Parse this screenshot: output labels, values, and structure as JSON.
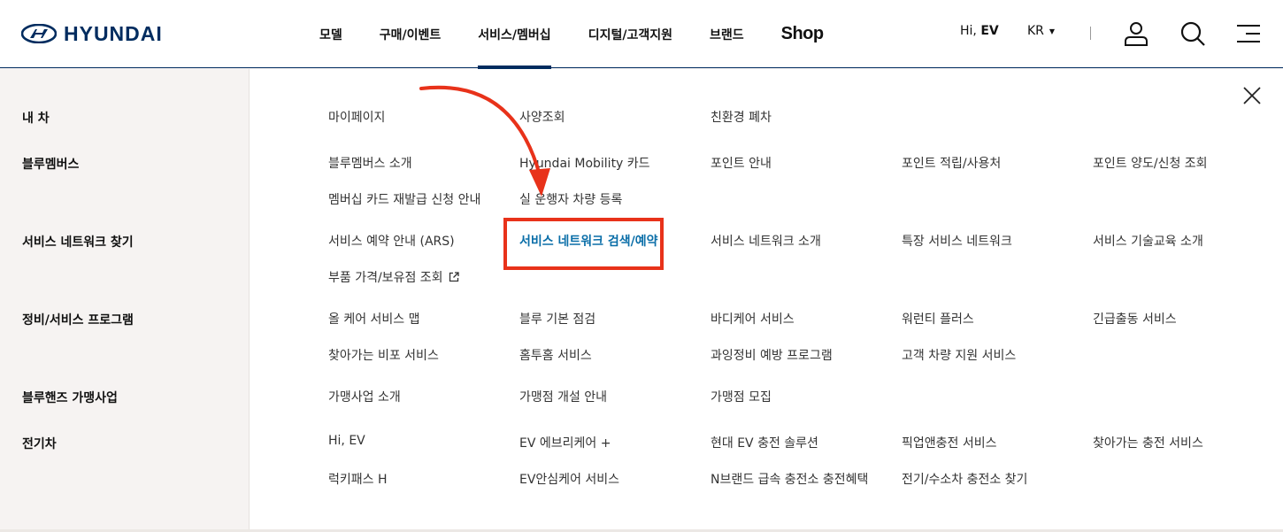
{
  "brand": {
    "logo_text": "HYUNDAI",
    "color": "#002c5f"
  },
  "header": {
    "nav": [
      {
        "label": "모델"
      },
      {
        "label": "구매/이벤트"
      },
      {
        "label": "서비스/멤버십",
        "active": true
      },
      {
        "label": "디지털/고객지원"
      },
      {
        "label": "브랜드"
      },
      {
        "label": "Shop"
      }
    ],
    "greeting_prefix": "Hi, ",
    "greeting_name": "EV",
    "lang": "KR",
    "icons": [
      "user-icon",
      "search-icon",
      "menu-icon"
    ]
  },
  "menu": {
    "categories": [
      {
        "label": "내 차",
        "links": [
          "마이페이지",
          "사양조회",
          "친환경 폐차"
        ]
      },
      {
        "label": "블루멤버스",
        "links": [
          "블루멤버스 소개",
          "Hyundai Mobility 카드",
          "포인트 안내",
          "포인트 적립/사용처",
          "포인트 양도/신청 조회",
          "멤버십 카드 재발급 신청 안내",
          "실 운행자 차량 등록"
        ]
      },
      {
        "label": "서비스 네트워크 찾기",
        "links": [
          "서비스 예약 안내 (ARS)",
          "서비스 네트워크 검색/예약",
          "서비스 네트워크 소개",
          "특장 서비스 네트워크",
          "서비스 기술교육 소개",
          "부품 가격/보유점 조회"
        ]
      },
      {
        "label": "정비/서비스 프로그램",
        "links": [
          "올 케어 서비스 맵",
          "블루 기본 점검",
          "바디케어 서비스",
          "워런티 플러스",
          "긴급출동 서비스",
          "찾아가는 비포 서비스",
          "홈투홈 서비스",
          "과잉정비 예방 프로그램",
          "고객 차량 지원 서비스"
        ]
      },
      {
        "label": "블루핸즈 가맹사업",
        "links": [
          "가맹사업 소개",
          "가맹점 개설 안내",
          "가맹점 모집"
        ]
      },
      {
        "label": "전기차",
        "links": [
          "Hi, EV",
          "EV 에브리케어 +",
          "현대 EV 충전 솔루션",
          "픽업앤충전 서비스",
          "찾아가는 충전 서비스",
          "럭키패스 H",
          "EV안심케어 서비스",
          "N브랜드 급속 충전소 충전혜택",
          "전기/수소차 충전소 찾기"
        ]
      }
    ],
    "highlighted_link": "서비스 네트워크 검색/예약",
    "external_link_icon": "external-link-icon",
    "accent_color": "#0a6ea8",
    "annotation_color": "#e8321a"
  }
}
